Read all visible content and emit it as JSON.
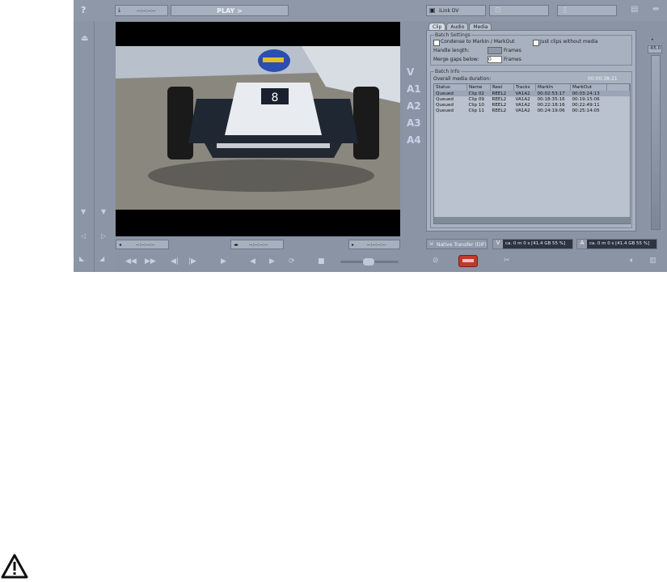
{
  "toolbar": {
    "help_icon": "question-icon",
    "timecode_in": "--:--:--:--",
    "mode": "PLAY >",
    "device": "iLink DV",
    "timecode_mid": "--:--:--:--",
    "timecode_out": "--:--:--:--"
  },
  "tracks": [
    "V",
    "A1",
    "A2",
    "A3",
    "A4"
  ],
  "tabs": [
    {
      "label": "Clip"
    },
    {
      "label": "Audio"
    },
    {
      "label": "Media"
    }
  ],
  "batch_settings": {
    "title": "Batch Settings",
    "condense_label": "Condense to MarkIn / MarkOut",
    "just_clips_label": "Just clips without media",
    "handle_label": "Handle length:",
    "handle_unit": "Frames",
    "merge_label": "Merge gaps below:",
    "merge_value": "0",
    "merge_unit": "Frames"
  },
  "batch_info": {
    "title": "Batch Info",
    "duration_label": "Overall media duration:",
    "duration_value": "00:00:38:21",
    "columns": [
      "Status",
      "Name",
      "Reel",
      "Tracks",
      "MarkIn",
      "MarkOut"
    ],
    "rows": [
      [
        "Queued",
        "Clip 02",
        "REEL2",
        "VA1A2",
        "00:02:53:17",
        "00:03:24:13"
      ],
      [
        "Queued",
        "Clip 09",
        "REEL2",
        "VA1A2",
        "00:18:35:16",
        "00:19:15:06"
      ],
      [
        "Queued",
        "Clip 10",
        "REEL2",
        "VA1A2",
        "00:22:18:16",
        "00:22:49:11"
      ],
      [
        "Queued",
        "Clip 11",
        "REEL2",
        "VA1A2",
        "00:24:19:06",
        "00:25:14:05"
      ]
    ]
  },
  "status": {
    "transfer": "Native Transfer (DIF)",
    "v_label": "V",
    "v_info": "ca.  0 m  0 s [41.4 GB 55 %]",
    "a_label": "A",
    "a_info": "ca.  0 m  0 s [41.4 GB 55 %]"
  },
  "meter": {
    "level": "-65.0"
  },
  "warning_icon": "warning-triangle-icon"
}
